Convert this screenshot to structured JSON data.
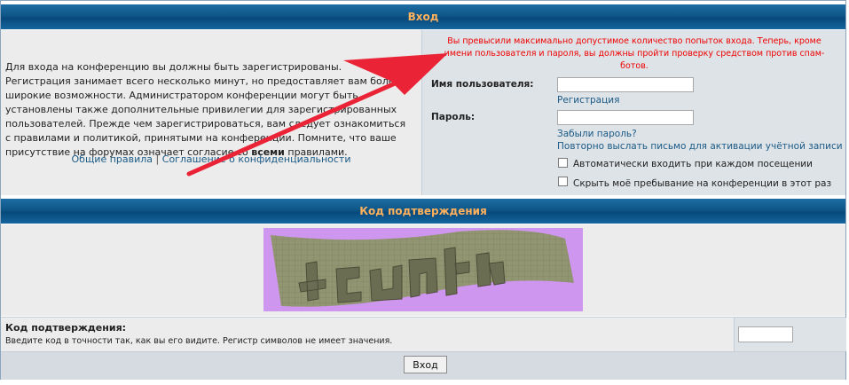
{
  "login_header": {
    "title": "Вход"
  },
  "left": {
    "info_before_bold": "Для входа на конференцию вы должны быть зарегистрированы. Регистрация занимает всего несколько минут, но предоставляет вам более широкие возможности. Администратором конференции могут быть установлены также дополнительные привилегии для зарегистрированных пользователей. Прежде чем зарегистрироваться, вам следует ознакомиться с правилами и политикой, принятыми на конференции. Помните, что ваше присутствие на форумах означает согласие со",
    "info_bold": "всеми",
    "info_after_bold": "правилами.",
    "rules_link": "Общие правила",
    "separator": "|",
    "privacy_link": "Соглашение о конфиденциальности"
  },
  "right": {
    "error_message": "Вы превысили максимально допустимое количество попыток входа. Теперь, кроме имени пользователя и пароля, вы должны пройти проверку средством против спам-ботов.",
    "username_label": "Имя пользователя:",
    "register_link": "Регистрация",
    "password_label": "Пароль:",
    "forgot_link": "Забыли пароль?",
    "resend_link": "Повторно выслать письмо для активации учётной записи",
    "autologin_label": "Автоматически входить при каждом посещении",
    "hide_label": "Скрыть моё пребывание на конференции в этот раз"
  },
  "captcha_header": {
    "title": "Код подтверждения"
  },
  "captcha": {
    "label": "Код подтверждения:",
    "hint": "Введите код в точности так, как вы его видите. Регистр символов не имеет значения."
  },
  "footer": {
    "submit_label": "Вход"
  },
  "colors": {
    "header": "#0e5688",
    "header_text": "#ffa34f",
    "error": "#ee0000",
    "link": "#1b5a86",
    "arrow": "#ea2436"
  }
}
